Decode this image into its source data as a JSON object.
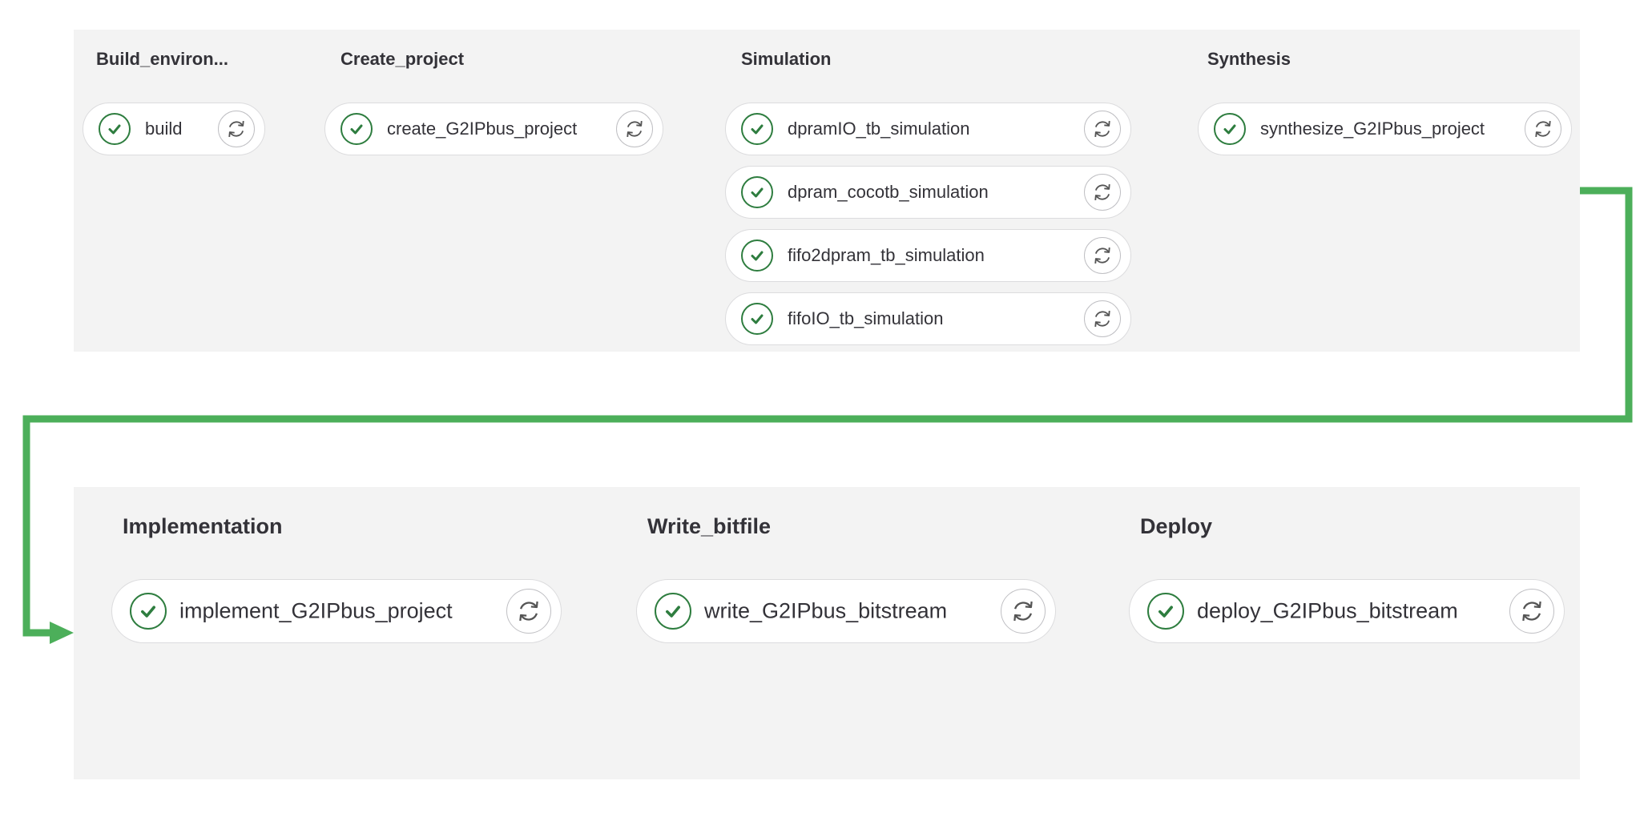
{
  "colors": {
    "success": "#2e7d3f",
    "connector": "#4caf5a",
    "panel_bg": "#f3f3f3"
  },
  "icons": {
    "status": "check-circle-icon",
    "retry": "retry-icon"
  },
  "stages": [
    {
      "title": "Build_environ...",
      "jobs": [
        {
          "name": "build",
          "status": "success"
        }
      ]
    },
    {
      "title": "Create_project",
      "jobs": [
        {
          "name": "create_G2IPbus_project",
          "status": "success"
        }
      ]
    },
    {
      "title": "Simulation",
      "jobs": [
        {
          "name": "dpramIO_tb_simulation",
          "status": "success"
        },
        {
          "name": "dpram_cocotb_simulation",
          "status": "success"
        },
        {
          "name": "fifo2dpram_tb_simulation",
          "status": "success"
        },
        {
          "name": "fifoIO_tb_simulation",
          "status": "success"
        }
      ]
    },
    {
      "title": "Synthesis",
      "jobs": [
        {
          "name": "synthesize_G2IPbus_project",
          "status": "success"
        }
      ]
    },
    {
      "title": "Implementation",
      "jobs": [
        {
          "name": "implement_G2IPbus_project",
          "status": "success"
        }
      ]
    },
    {
      "title": "Write_bitfile",
      "jobs": [
        {
          "name": "write_G2IPbus_bitstream",
          "status": "success"
        }
      ]
    },
    {
      "title": "Deploy",
      "jobs": [
        {
          "name": "deploy_G2IPbus_bitstream",
          "status": "success"
        }
      ]
    }
  ]
}
